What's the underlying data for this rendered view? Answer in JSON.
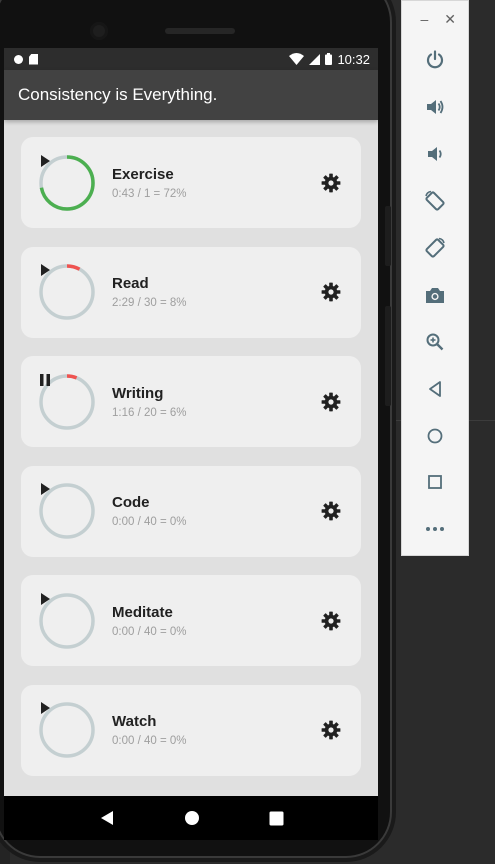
{
  "status_bar": {
    "time": "10:32"
  },
  "app_bar": {
    "title": "Consistency is Everything."
  },
  "colors": {
    "progress_green": "#4caf50",
    "progress_red": "#ef5350",
    "ring_track": "#c4cfd1",
    "app_bar": "#424242"
  },
  "tasks": [
    {
      "name": "Exercise",
      "stats": "0:43 / 1 = 72%",
      "progress": 0.72,
      "color": "#4caf50",
      "state": "play"
    },
    {
      "name": "Read",
      "stats": "2:29 / 30 = 8%",
      "progress": 0.08,
      "color": "#ef5350",
      "state": "play"
    },
    {
      "name": "Writing",
      "stats": "1:16 / 20 = 6%",
      "progress": 0.06,
      "color": "#ef5350",
      "state": "pause"
    },
    {
      "name": "Code",
      "stats": "0:00 / 40 = 0%",
      "progress": 0.0,
      "color": "#ef5350",
      "state": "play"
    },
    {
      "name": "Meditate",
      "stats": "0:00 / 40 = 0%",
      "progress": 0.0,
      "color": "#ef5350",
      "state": "play"
    },
    {
      "name": "Watch",
      "stats": "0:00 / 40 = 0%",
      "progress": 0.0,
      "color": "#ef5350",
      "state": "play"
    }
  ],
  "emulator_toolbar": {
    "items": [
      "power-icon",
      "volume-up-icon",
      "volume-down-icon",
      "rotate-left-icon",
      "rotate-right-icon",
      "camera-icon",
      "zoom-icon",
      "back-icon",
      "home-icon",
      "overview-icon",
      "more-icon"
    ]
  }
}
